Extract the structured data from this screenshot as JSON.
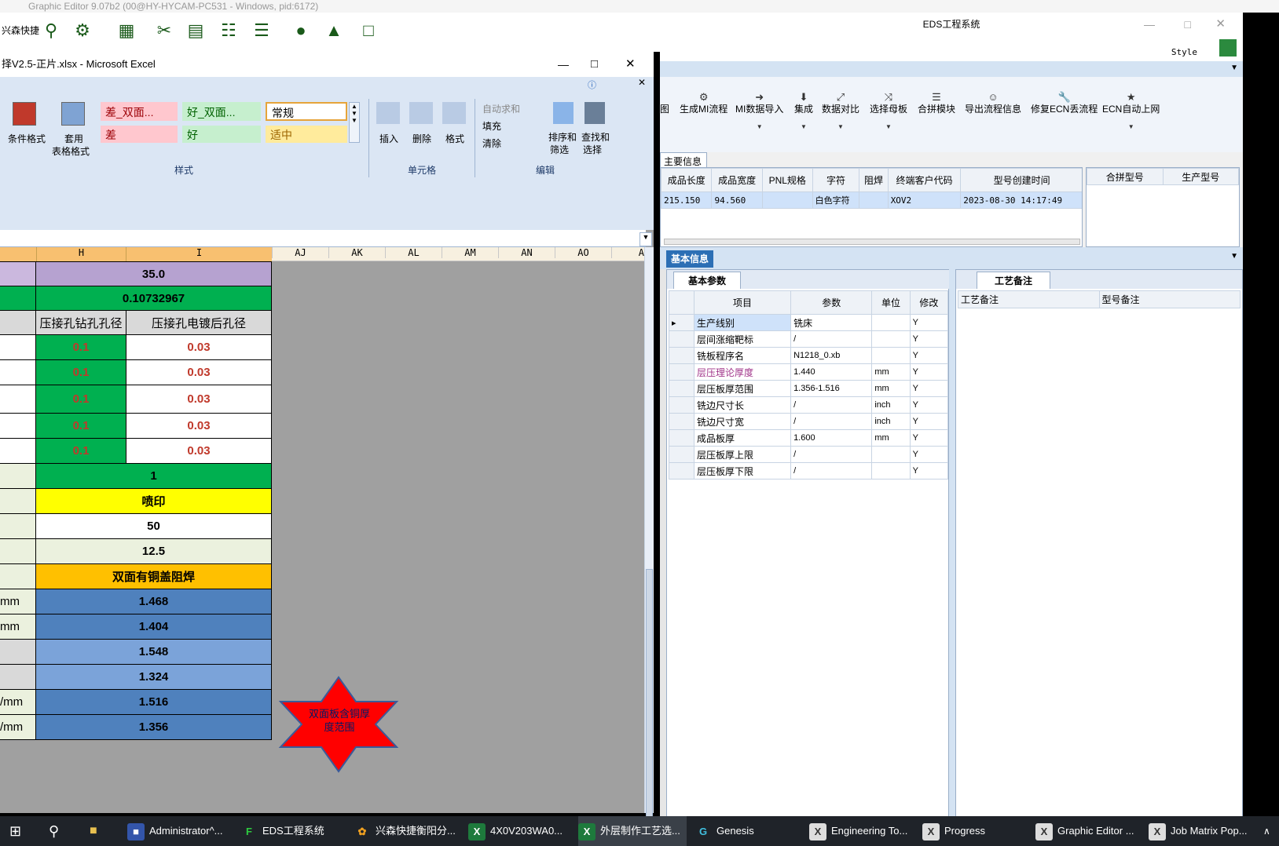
{
  "ge": {
    "title": "Graphic Editor 9.07b2 (00@HY-HYCAM-PC531 - Windows, pid:6172)",
    "quick_label": "兴森快捷",
    "tools": [
      "search-icon",
      "settings-icon",
      "grid-icon",
      "scissors-icon",
      "film-icon",
      "clipboard-icon",
      "list-icon",
      "user-icon",
      "chart-icon",
      "window-icon"
    ],
    "style_label": "Style"
  },
  "eds": {
    "title": "EDS工程系统",
    "ribbon": [
      {
        "label": "图",
        "icon": ""
      },
      {
        "label": "生成MI流程",
        "icon": "⚙"
      },
      {
        "label": "MI数据导入",
        "icon": "➜"
      },
      {
        "label": "集成",
        "icon": "⬇"
      },
      {
        "label": "数据对比",
        "icon": "⤢"
      },
      {
        "label": "选择母板",
        "icon": "⤨"
      },
      {
        "label": "合拼模块",
        "icon": "☰"
      },
      {
        "label": "导出流程信息",
        "icon": "☺"
      },
      {
        "label": "修复ECN丢流程",
        "icon": "🔧"
      },
      {
        "label": "ECN自动上网",
        "icon": "★"
      }
    ],
    "main_tab": "主要信息",
    "main_table": {
      "headers": [
        "成品长度",
        "成品宽度",
        "PNL规格",
        "字符",
        "阻焊",
        "终端客户代码",
        "型号创建时间"
      ],
      "row": [
        "215.150",
        "94.560",
        "",
        "白色字符",
        "",
        "XOV2",
        "2023-08-30 14:17:49"
      ]
    },
    "side_headers": [
      "合拼型号",
      "生产型号"
    ],
    "basic_tab": "基本信息",
    "basic_params_tab": "基本参数",
    "craft_tab": "工艺备注",
    "param_headers": [
      "项目",
      "参数",
      "单位",
      "修改"
    ],
    "params": [
      {
        "item": "生产线别",
        "value": "铣床",
        "unit": "",
        "mod": "Y"
      },
      {
        "item": "层间涨缩靶标",
        "value": "/",
        "unit": "",
        "mod": "Y"
      },
      {
        "item": "铣板程序名",
        "value": "N1218_0.xb",
        "unit": "",
        "mod": "Y"
      },
      {
        "item": "层压理论厚度",
        "value": "1.440",
        "unit": "mm",
        "mod": "Y"
      },
      {
        "item": "层压板厚范围",
        "value": "1.356-1.516",
        "unit": "mm",
        "mod": "Y"
      },
      {
        "item": "铣边尺寸长",
        "value": "/",
        "unit": "inch",
        "mod": "Y"
      },
      {
        "item": "铣边尺寸宽",
        "value": "/",
        "unit": "inch",
        "mod": "Y"
      },
      {
        "item": "成品板厚",
        "value": "1.600",
        "unit": "mm",
        "mod": "Y"
      },
      {
        "item": "层压板厚上限",
        "value": "/",
        "unit": "",
        "mod": "Y"
      },
      {
        "item": "层压板厚下限",
        "value": "/",
        "unit": "",
        "mod": "Y"
      }
    ],
    "craft_headers": [
      "工艺备注",
      "型号备注"
    ]
  },
  "excel": {
    "title": "择V2.5-正片.xlsx - Microsoft Excel",
    "styles": {
      "bad_double": "差_双面...",
      "good_double": "好_双面...",
      "normal": "常规",
      "bad": "差",
      "good": "好",
      "neutral": "适中"
    },
    "ribbon": {
      "cond_format": "条件格式",
      "table_format_1": "套用",
      "table_format_2": "表格格式",
      "insert": "插入",
      "delete": "删除",
      "format": "格式",
      "autosum": "自动求和",
      "fill": "填充",
      "clear": "清除",
      "sort_1": "排序和",
      "sort_2": "筛选",
      "find_1": "查找和",
      "find_2": "选择",
      "group_styles": "样式",
      "group_cells": "单元格",
      "group_edit": "编辑"
    },
    "columns": [
      "H",
      "I",
      "AJ",
      "AK",
      "AL",
      "AM",
      "AN",
      "AO",
      "A"
    ],
    "rows": {
      "r1": "35.0",
      "r2": "0.10732967",
      "hdr_h": "压接孔钻孔孔径",
      "hdr_i": "压接孔电镀后孔径",
      "drill": [
        "0.1",
        "0.1",
        "0.1",
        "0.1",
        "0.1"
      ],
      "plate": [
        "0.03",
        "0.03",
        "0.03",
        "0.03",
        "0.03"
      ],
      "r_one": "1",
      "r_print": "喷印",
      "r_50": "50",
      "r_125": "12.5",
      "r_cover": "双面有铜盖阻焊",
      "v1": "1.468",
      "v2": "1.404",
      "v3": "1.548",
      "v4": "1.324",
      "v5": "1.516",
      "v6": "1.356",
      "left_units": [
        "mm",
        "mm",
        "",
        "",
        "/mm",
        "/mm"
      ]
    },
    "star_text": "双面板含铜厚度范围"
  },
  "taskbar": {
    "items": [
      {
        "label": "Administrator^...",
        "icon": "💾"
      },
      {
        "label": "EDS工程系统",
        "icon": "F"
      },
      {
        "label": "兴森快捷衡阳分...",
        "icon": "✿"
      },
      {
        "label": "4X0V203WA0...",
        "icon": "X"
      },
      {
        "label": "外层制作工艺选...",
        "icon": "X"
      },
      {
        "label": "Genesis",
        "icon": "G"
      },
      {
        "label": "Engineering To...",
        "icon": "X"
      },
      {
        "label": "Progress",
        "icon": "X"
      },
      {
        "label": "Graphic Editor ...",
        "icon": "X"
      },
      {
        "label": "Job Matrix Pop...",
        "icon": "X"
      }
    ]
  }
}
